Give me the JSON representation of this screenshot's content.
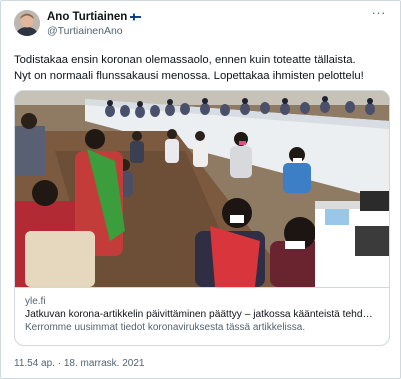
{
  "author": {
    "name": "Ano Turtiainen",
    "flag": "finland-flag",
    "handle": "@TurtiainenAno"
  },
  "more_icon": "more-horizontal-icon",
  "tweet": {
    "lines": [
      "Todistakaa ensin koronan olemassaolo, ennen kuin toteatte tällaista.",
      "Nyt on normaali flunssakausi menossa. Lopettakaa ihmisten pelottelu!"
    ]
  },
  "card": {
    "domain": "yle.fi",
    "title": "Jatkuvan korona-artikkelin päivittäminen päättyy – jatkossa käänteistä tehd…",
    "description": "Kerromme uusimmat tiedot koronaviruksesta tässä artikkelissa."
  },
  "timestamp": {
    "time": "11.54 ap.",
    "separator": "·",
    "date": "18. marrask. 2021"
  },
  "colors": {
    "text": "#0f1419",
    "secondary": "#536471",
    "border": "#cfd9de"
  }
}
